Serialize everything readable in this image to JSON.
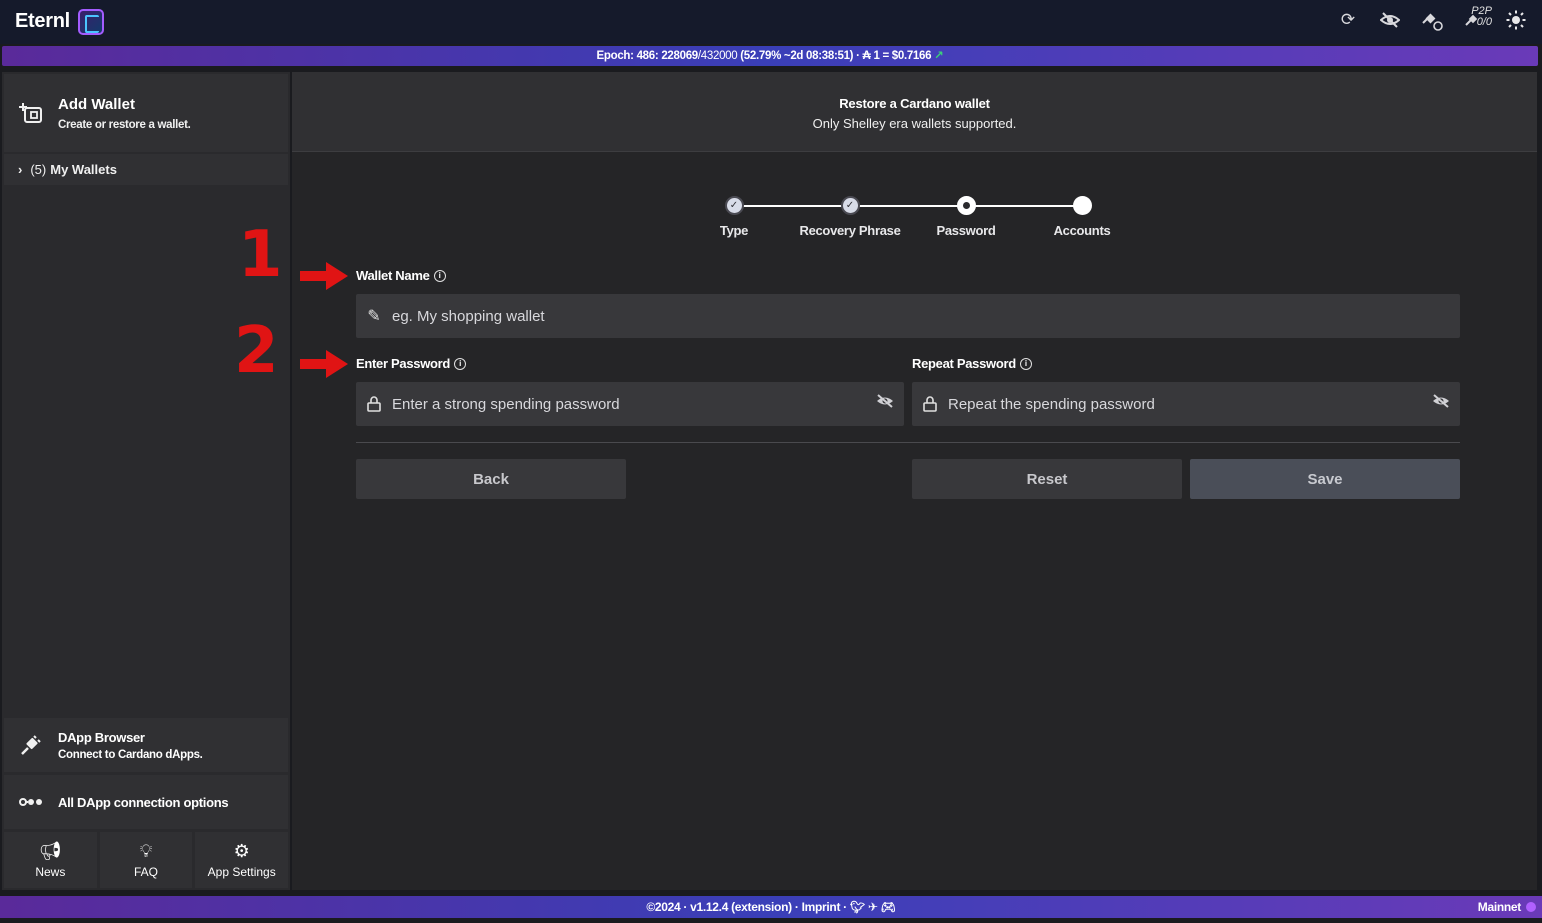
{
  "app": {
    "name": "Eternl"
  },
  "top_icons": [
    "sync-icon",
    "hide-balance-icon",
    "network-satellite-icon",
    "p2p-icon",
    "theme-sun-icon"
  ],
  "p2p": {
    "label": "P2P",
    "count": "0/0"
  },
  "epoch_bar": {
    "epoch_label": "Epoch: 486:",
    "slot": "228069",
    "slot_total": "/432000",
    "percent": "(52.79%",
    "remaining": "~2d 08:38:51)",
    "price": "· ₳ 1 = $0.7166"
  },
  "sidebar": {
    "add_wallet_title": "Add Wallet",
    "add_wallet_sub": "Create or restore a wallet.",
    "wallets_count": "(5)",
    "wallets_label": "My Wallets",
    "dapp_title": "DApp Browser",
    "dapp_sub": "Connect to Cardano dApps.",
    "dapp_conn": "All DApp connection options",
    "bottom": {
      "news": "News",
      "faq": "FAQ",
      "settings": "App Settings"
    }
  },
  "header": {
    "title": "Restore a Cardano wallet",
    "subtitle": "Only Shelley era wallets supported."
  },
  "stepper": {
    "steps": [
      "Type",
      "Recovery Phrase",
      "Password",
      "Accounts"
    ],
    "current_step": 3
  },
  "annotations": {
    "one": "1",
    "two": "2"
  },
  "form": {
    "wallet_name_label": "Wallet Name",
    "wallet_name_placeholder": "eg. My shopping wallet",
    "password_label": "Enter Password",
    "password_placeholder": "Enter a strong spending password",
    "repeat_label": "Repeat Password",
    "repeat_placeholder": "Repeat the spending password"
  },
  "buttons": {
    "back": "Back",
    "reset": "Reset",
    "save": "Save"
  },
  "footer": {
    "text": "©2024 · v1.12.4 (extension) · Imprint ·",
    "network": "Mainnet"
  },
  "colors": {
    "accent": "#5a2a9a",
    "annotation": "#e01414",
    "background": "#252527"
  }
}
